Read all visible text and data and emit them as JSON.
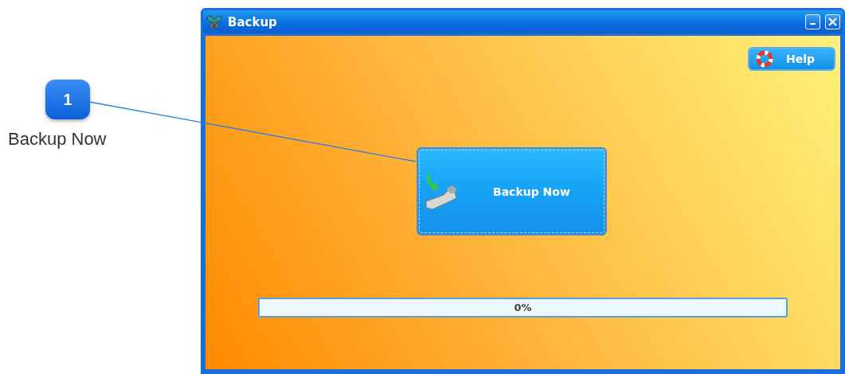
{
  "callout": {
    "number": "1",
    "label": "Backup Now"
  },
  "window": {
    "title": "Backup"
  },
  "help_button": {
    "label": "Help"
  },
  "backup_button": {
    "label": "Backup Now"
  },
  "progress": {
    "level": 0,
    "reading": "0%"
  }
}
